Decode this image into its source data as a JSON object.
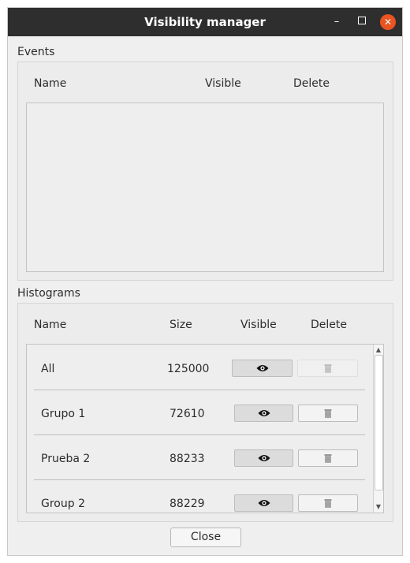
{
  "window": {
    "title": "Visibility manager",
    "controls": {
      "minimize": "–",
      "maximize": "",
      "close": "✕"
    }
  },
  "events": {
    "label": "Events",
    "columns": {
      "name": "Name",
      "visible": "Visible",
      "delete": "Delete"
    },
    "rows": []
  },
  "histograms": {
    "label": "Histograms",
    "columns": {
      "name": "Name",
      "size": "Size",
      "visible": "Visible",
      "delete": "Delete"
    },
    "rows": [
      {
        "name": "All",
        "size": "125000",
        "delete_enabled": false
      },
      {
        "name": "Grupo 1",
        "size": "72610",
        "delete_enabled": true
      },
      {
        "name": "Prueba 2",
        "size": "88233",
        "delete_enabled": true
      },
      {
        "name": "Group 2",
        "size": "88229",
        "delete_enabled": true
      }
    ],
    "scrollbar": {
      "up_arrow": "▲",
      "down_arrow": "▼"
    }
  },
  "footer": {
    "close_label": "Close"
  },
  "icons": {
    "visible": "eye-icon",
    "delete": "trash-icon",
    "close": "close-icon"
  },
  "colors": {
    "titlebar": "#2e2e2e",
    "close_accent": "#e95420"
  }
}
